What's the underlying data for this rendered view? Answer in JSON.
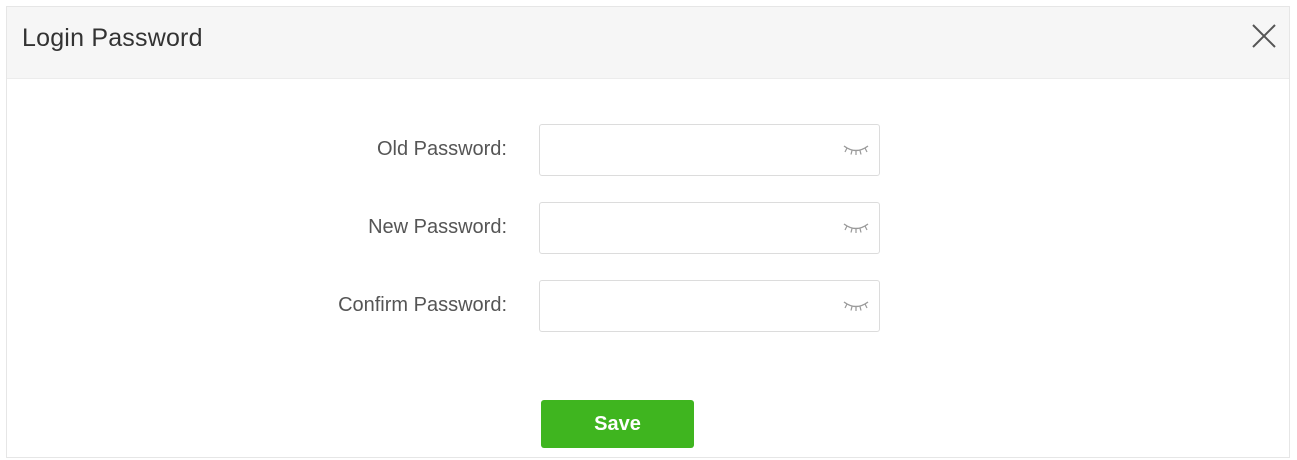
{
  "dialog": {
    "title": "Login Password",
    "close_icon": "close-icon"
  },
  "form": {
    "fields": [
      {
        "label": "Old Password:",
        "value": "",
        "placeholder": "",
        "toggle_icon": "eye-closed-icon"
      },
      {
        "label": "New Password:",
        "value": "",
        "placeholder": "",
        "toggle_icon": "eye-closed-icon"
      },
      {
        "label": "Confirm Password:",
        "value": "",
        "placeholder": "",
        "toggle_icon": "eye-closed-icon"
      }
    ],
    "save_label": "Save"
  },
  "colors": {
    "accent": "#3fb51f",
    "header_bg": "#f6f6f6",
    "label_text": "#555555"
  }
}
